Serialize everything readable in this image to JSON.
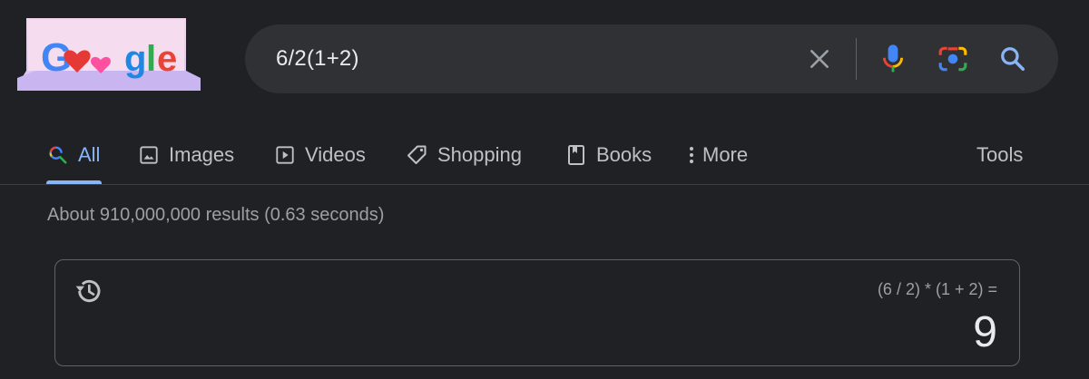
{
  "logo": {
    "text": "Google"
  },
  "search": {
    "query": "6/2(1+2)",
    "icons": [
      "close-icon",
      "mic-icon",
      "camera-icon",
      "search-icon"
    ]
  },
  "tabs": [
    {
      "label": "All",
      "icon": "multicolor-search-icon",
      "active": true
    },
    {
      "label": "Images",
      "icon": "image-icon",
      "active": false
    },
    {
      "label": "Videos",
      "icon": "play-icon",
      "active": false
    },
    {
      "label": "Shopping",
      "icon": "tag-icon",
      "active": false
    },
    {
      "label": "Books",
      "icon": "book-icon",
      "active": false
    },
    {
      "label": "More",
      "icon": "more-vertical-icon",
      "active": false
    }
  ],
  "tools_label": "Tools",
  "result_stats": "About 910,000,000 results (0.63 seconds)",
  "calculator": {
    "expression": "(6 / 2) * (1 + 2) =",
    "result": "9",
    "icon": "history-icon"
  },
  "colors": {
    "background": "#202124",
    "searchbar": "#303134",
    "accent": "#8ab4f8",
    "text": "#bdc1c6",
    "muted": "#9aa0a6"
  }
}
